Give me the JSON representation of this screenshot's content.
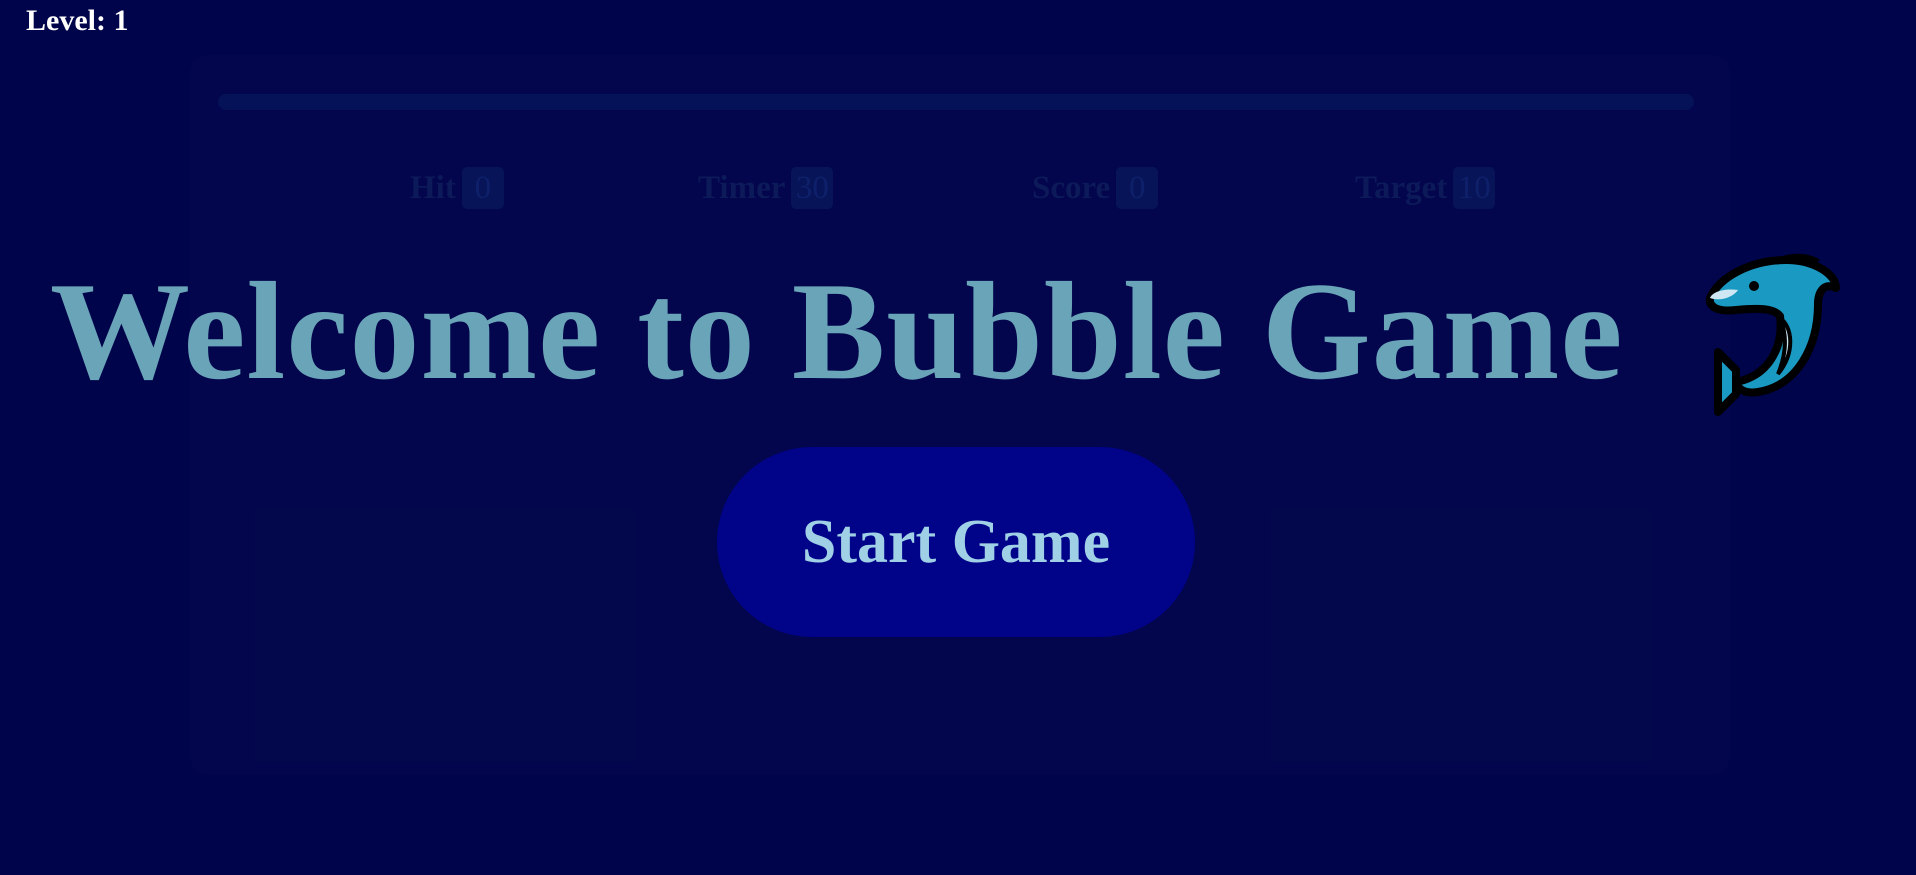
{
  "hud": {
    "level_label": "Level: 1"
  },
  "progress": {
    "fraction": 0
  },
  "stats": {
    "hit": {
      "label": "Hit",
      "value": "0"
    },
    "timer": {
      "label": "Timer",
      "value": "30"
    },
    "score": {
      "label": "Score",
      "value": "0"
    },
    "target": {
      "label": "Target",
      "value": "10"
    }
  },
  "welcome": {
    "title": "Welcome to Bubble Game",
    "icon": "dolphin-emoji"
  },
  "start_button": {
    "label": "Start Game"
  },
  "colors": {
    "background": "#00044a",
    "title": "#6aa4b8",
    "button": "#010389",
    "button_text": "#9fd0e6",
    "dolphin": "#1a9ac2"
  }
}
